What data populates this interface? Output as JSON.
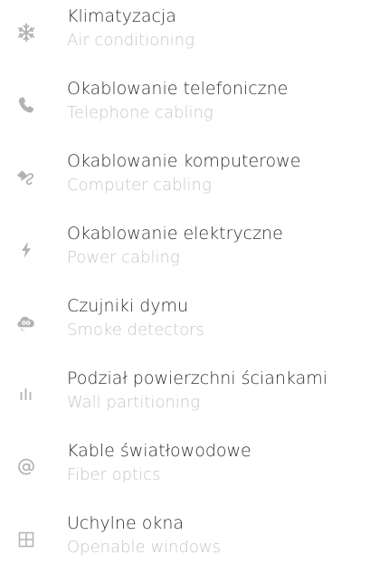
{
  "features": [
    {
      "title": "Klimatyzacja",
      "subtitle": "Air conditioning",
      "icon": "snowflake-icon",
      "icon_color": "#b3b3b3"
    },
    {
      "title": "Okablowanie telefoniczne",
      "subtitle": "Telephone cabling",
      "icon": "phone-icon",
      "icon_color": "#b3b3b3"
    },
    {
      "title": "Okablowanie komputerowe",
      "subtitle": "Computer cabling",
      "icon": "computer-cable-icon",
      "icon_color": "#b3b3b3"
    },
    {
      "title": "Okablowanie elektryczne",
      "subtitle": "Power cabling",
      "icon": "lightning-icon",
      "icon_color": "#b3b3b3"
    },
    {
      "title": "Czujniki dymu",
      "subtitle": "Smoke detectors",
      "icon": "smoke-detector-icon",
      "icon_color": "#b3b3b3"
    },
    {
      "title": "Podział powierzchni ściankami",
      "subtitle": "Wall partitioning",
      "icon": "partition-icon",
      "icon_color": "#b3b3b3"
    },
    {
      "title": "Kable światłowodowe",
      "subtitle": "Fiber optics",
      "icon": "at-sign-icon",
      "icon_color": "#b3b3b3"
    },
    {
      "title": "Uchylne okna",
      "subtitle": "Openable windows",
      "icon": "window-icon",
      "icon_color": "#b3b3b3"
    }
  ]
}
